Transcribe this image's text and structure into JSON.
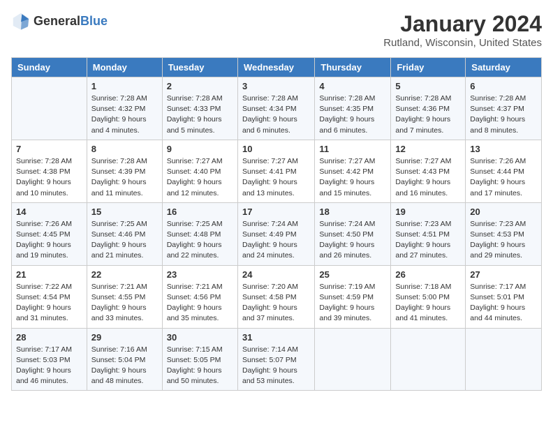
{
  "header": {
    "logo_general": "General",
    "logo_blue": "Blue",
    "month": "January 2024",
    "location": "Rutland, Wisconsin, United States"
  },
  "days_of_week": [
    "Sunday",
    "Monday",
    "Tuesday",
    "Wednesday",
    "Thursday",
    "Friday",
    "Saturday"
  ],
  "weeks": [
    [
      {
        "day": "",
        "info": ""
      },
      {
        "day": "1",
        "info": "Sunrise: 7:28 AM\nSunset: 4:32 PM\nDaylight: 9 hours\nand 4 minutes."
      },
      {
        "day": "2",
        "info": "Sunrise: 7:28 AM\nSunset: 4:33 PM\nDaylight: 9 hours\nand 5 minutes."
      },
      {
        "day": "3",
        "info": "Sunrise: 7:28 AM\nSunset: 4:34 PM\nDaylight: 9 hours\nand 6 minutes."
      },
      {
        "day": "4",
        "info": "Sunrise: 7:28 AM\nSunset: 4:35 PM\nDaylight: 9 hours\nand 6 minutes."
      },
      {
        "day": "5",
        "info": "Sunrise: 7:28 AM\nSunset: 4:36 PM\nDaylight: 9 hours\nand 7 minutes."
      },
      {
        "day": "6",
        "info": "Sunrise: 7:28 AM\nSunset: 4:37 PM\nDaylight: 9 hours\nand 8 minutes."
      }
    ],
    [
      {
        "day": "7",
        "info": "Sunrise: 7:28 AM\nSunset: 4:38 PM\nDaylight: 9 hours\nand 10 minutes."
      },
      {
        "day": "8",
        "info": "Sunrise: 7:28 AM\nSunset: 4:39 PM\nDaylight: 9 hours\nand 11 minutes."
      },
      {
        "day": "9",
        "info": "Sunrise: 7:27 AM\nSunset: 4:40 PM\nDaylight: 9 hours\nand 12 minutes."
      },
      {
        "day": "10",
        "info": "Sunrise: 7:27 AM\nSunset: 4:41 PM\nDaylight: 9 hours\nand 13 minutes."
      },
      {
        "day": "11",
        "info": "Sunrise: 7:27 AM\nSunset: 4:42 PM\nDaylight: 9 hours\nand 15 minutes."
      },
      {
        "day": "12",
        "info": "Sunrise: 7:27 AM\nSunset: 4:43 PM\nDaylight: 9 hours\nand 16 minutes."
      },
      {
        "day": "13",
        "info": "Sunrise: 7:26 AM\nSunset: 4:44 PM\nDaylight: 9 hours\nand 17 minutes."
      }
    ],
    [
      {
        "day": "14",
        "info": "Sunrise: 7:26 AM\nSunset: 4:45 PM\nDaylight: 9 hours\nand 19 minutes."
      },
      {
        "day": "15",
        "info": "Sunrise: 7:25 AM\nSunset: 4:46 PM\nDaylight: 9 hours\nand 21 minutes."
      },
      {
        "day": "16",
        "info": "Sunrise: 7:25 AM\nSunset: 4:48 PM\nDaylight: 9 hours\nand 22 minutes."
      },
      {
        "day": "17",
        "info": "Sunrise: 7:24 AM\nSunset: 4:49 PM\nDaylight: 9 hours\nand 24 minutes."
      },
      {
        "day": "18",
        "info": "Sunrise: 7:24 AM\nSunset: 4:50 PM\nDaylight: 9 hours\nand 26 minutes."
      },
      {
        "day": "19",
        "info": "Sunrise: 7:23 AM\nSunset: 4:51 PM\nDaylight: 9 hours\nand 27 minutes."
      },
      {
        "day": "20",
        "info": "Sunrise: 7:23 AM\nSunset: 4:53 PM\nDaylight: 9 hours\nand 29 minutes."
      }
    ],
    [
      {
        "day": "21",
        "info": "Sunrise: 7:22 AM\nSunset: 4:54 PM\nDaylight: 9 hours\nand 31 minutes."
      },
      {
        "day": "22",
        "info": "Sunrise: 7:21 AM\nSunset: 4:55 PM\nDaylight: 9 hours\nand 33 minutes."
      },
      {
        "day": "23",
        "info": "Sunrise: 7:21 AM\nSunset: 4:56 PM\nDaylight: 9 hours\nand 35 minutes."
      },
      {
        "day": "24",
        "info": "Sunrise: 7:20 AM\nSunset: 4:58 PM\nDaylight: 9 hours\nand 37 minutes."
      },
      {
        "day": "25",
        "info": "Sunrise: 7:19 AM\nSunset: 4:59 PM\nDaylight: 9 hours\nand 39 minutes."
      },
      {
        "day": "26",
        "info": "Sunrise: 7:18 AM\nSunset: 5:00 PM\nDaylight: 9 hours\nand 41 minutes."
      },
      {
        "day": "27",
        "info": "Sunrise: 7:17 AM\nSunset: 5:01 PM\nDaylight: 9 hours\nand 44 minutes."
      }
    ],
    [
      {
        "day": "28",
        "info": "Sunrise: 7:17 AM\nSunset: 5:03 PM\nDaylight: 9 hours\nand 46 minutes."
      },
      {
        "day": "29",
        "info": "Sunrise: 7:16 AM\nSunset: 5:04 PM\nDaylight: 9 hours\nand 48 minutes."
      },
      {
        "day": "30",
        "info": "Sunrise: 7:15 AM\nSunset: 5:05 PM\nDaylight: 9 hours\nand 50 minutes."
      },
      {
        "day": "31",
        "info": "Sunrise: 7:14 AM\nSunset: 5:07 PM\nDaylight: 9 hours\nand 53 minutes."
      },
      {
        "day": "",
        "info": ""
      },
      {
        "day": "",
        "info": ""
      },
      {
        "day": "",
        "info": ""
      }
    ]
  ]
}
